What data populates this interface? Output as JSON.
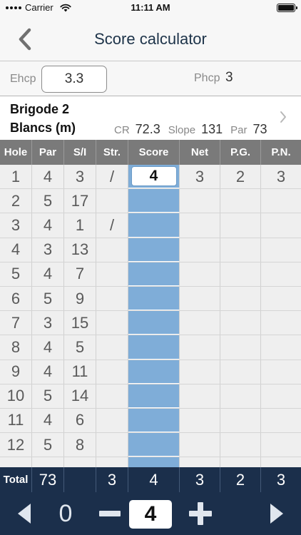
{
  "status_bar": {
    "carrier": "Carrier",
    "time": "11:11 AM"
  },
  "nav": {
    "title": "Score calculator",
    "back_icon": "chevron-left-icon"
  },
  "handicap": {
    "ehcp_label": "Ehcp",
    "ehcp_value": "3.3",
    "phcp_label": "Phcp",
    "phcp_value": "3"
  },
  "course": {
    "name_line1": "Brigode 2",
    "name_line2": "Blancs (m)",
    "cr_label": "CR",
    "cr_value": "72.3",
    "slope_label": "Slope",
    "slope_value": "131",
    "par_label": "Par",
    "par_value": "73"
  },
  "table": {
    "headers": {
      "hole": "Hole",
      "par": "Par",
      "si": "S/I",
      "str": "Str.",
      "score": "Score",
      "net": "Net",
      "pg": "P.G.",
      "pn": "P.N."
    },
    "rows": [
      {
        "hole": "1",
        "par": "4",
        "si": "3",
        "str": "/",
        "score": "4",
        "net": "3",
        "pg": "2",
        "pn": "3"
      },
      {
        "hole": "2",
        "par": "5",
        "si": "17",
        "str": "",
        "score": "",
        "net": "",
        "pg": "",
        "pn": ""
      },
      {
        "hole": "3",
        "par": "4",
        "si": "1",
        "str": "/",
        "score": "",
        "net": "",
        "pg": "",
        "pn": ""
      },
      {
        "hole": "4",
        "par": "3",
        "si": "13",
        "str": "",
        "score": "",
        "net": "",
        "pg": "",
        "pn": ""
      },
      {
        "hole": "5",
        "par": "4",
        "si": "7",
        "str": "",
        "score": "",
        "net": "",
        "pg": "",
        "pn": ""
      },
      {
        "hole": "6",
        "par": "5",
        "si": "9",
        "str": "",
        "score": "",
        "net": "",
        "pg": "",
        "pn": ""
      },
      {
        "hole": "7",
        "par": "3",
        "si": "15",
        "str": "",
        "score": "",
        "net": "",
        "pg": "",
        "pn": ""
      },
      {
        "hole": "8",
        "par": "4",
        "si": "5",
        "str": "",
        "score": "",
        "net": "",
        "pg": "",
        "pn": ""
      },
      {
        "hole": "9",
        "par": "4",
        "si": "11",
        "str": "",
        "score": "",
        "net": "",
        "pg": "",
        "pn": ""
      },
      {
        "hole": "10",
        "par": "5",
        "si": "14",
        "str": "",
        "score": "",
        "net": "",
        "pg": "",
        "pn": ""
      },
      {
        "hole": "11",
        "par": "4",
        "si": "6",
        "str": "",
        "score": "",
        "net": "",
        "pg": "",
        "pn": ""
      },
      {
        "hole": "12",
        "par": "5",
        "si": "8",
        "str": "",
        "score": "",
        "net": "",
        "pg": "",
        "pn": ""
      }
    ],
    "total": {
      "label": "Total",
      "par": "73",
      "si": "",
      "str": "3",
      "score": "4",
      "net": "3",
      "pg": "2",
      "pn": "3"
    }
  },
  "toolbar": {
    "prev_icon": "triangle-left-icon",
    "zero_label": "0",
    "minus_icon": "minus-icon",
    "value": "4",
    "plus_icon": "plus-icon",
    "next_icon": "triangle-right-icon"
  },
  "colors": {
    "nav_bg": "#f7f7f7",
    "header_bg": "#7a7a7a",
    "score_column": "#7fadd8",
    "footer_bg": "#1b2f4b"
  }
}
